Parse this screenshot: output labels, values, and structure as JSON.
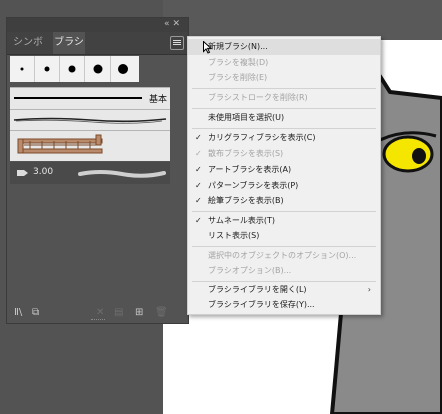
{
  "panel": {
    "tabs": [
      {
        "label": "シンボル"
      },
      {
        "label": "ブラシ"
      }
    ],
    "titlebar_icons": "«✕",
    "basic_label": "基本",
    "size_value": "3.00"
  },
  "menu": {
    "items": [
      {
        "label": "新規ブラシ(N)...",
        "enabled": true,
        "checked": false
      },
      {
        "label": "ブラシを複製(D)",
        "enabled": false,
        "checked": false
      },
      {
        "label": "ブラシを削除(E)",
        "enabled": false,
        "checked": false
      },
      {
        "label": "ブラシストロークを削除(R)",
        "enabled": false,
        "checked": false
      },
      {
        "label": "未使用項目を選択(U)",
        "enabled": true,
        "checked": false
      },
      {
        "label": "カリグラフィブラシを表示(C)",
        "enabled": true,
        "checked": true
      },
      {
        "label": "散布ブラシを表示(S)",
        "enabled": false,
        "checked": true
      },
      {
        "label": "アートブラシを表示(A)",
        "enabled": true,
        "checked": true
      },
      {
        "label": "パターンブラシを表示(P)",
        "enabled": true,
        "checked": true
      },
      {
        "label": "絵筆ブラシを表示(B)",
        "enabled": true,
        "checked": true
      },
      {
        "label": "サムネール表示(T)",
        "enabled": true,
        "checked": true
      },
      {
        "label": "リスト表示(S)",
        "enabled": true,
        "checked": false
      },
      {
        "label": "選択中のオブジェクトのオプション(O)...",
        "enabled": false,
        "checked": false
      },
      {
        "label": "ブラシオプション(B)...",
        "enabled": false,
        "checked": false
      },
      {
        "label": "ブラシライブラリを開く(L)",
        "enabled": true,
        "checked": false,
        "submenu": true
      },
      {
        "label": "ブラシライブラリを保存(Y)...",
        "enabled": true,
        "checked": false
      }
    ],
    "check_glyph": "✓",
    "submenu_glyph": "›"
  },
  "colors": {
    "cat_fill": "#8a8a8a",
    "cat_eye": "#f5e600",
    "menu_bg": "#f0f0f0"
  }
}
